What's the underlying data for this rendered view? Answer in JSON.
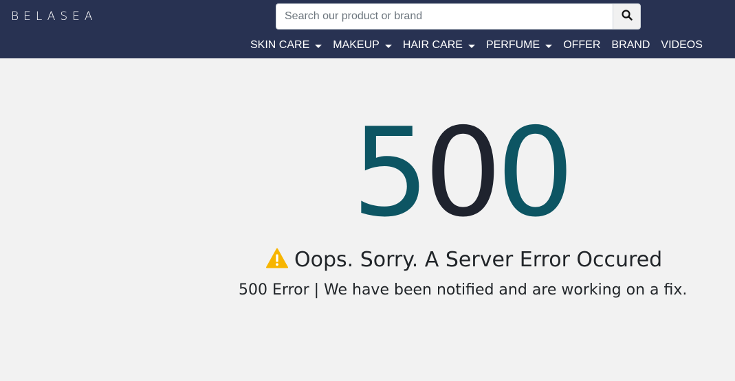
{
  "header": {
    "logo": "BELASEA",
    "search": {
      "placeholder": "Search our product or brand",
      "value": ""
    },
    "nav": [
      {
        "label": "SKIN CARE",
        "dropdown": true
      },
      {
        "label": "MAKEUP",
        "dropdown": true
      },
      {
        "label": "HAIR CARE",
        "dropdown": true
      },
      {
        "label": "PERFUME",
        "dropdown": true
      },
      {
        "label": "OFFER",
        "dropdown": false
      },
      {
        "label": "BRAND",
        "dropdown": false
      },
      {
        "label": "VIDEOS",
        "dropdown": false
      }
    ]
  },
  "error": {
    "code_digits": [
      "5",
      "0",
      "0"
    ],
    "title": "Oops. Sorry. A Server Error Occured",
    "message": "500 Error | We have been notified and are working on a fix.",
    "icon": "warning-icon"
  },
  "colors": {
    "header_bg": "#283252",
    "page_bg": "#f2f2f2",
    "teal": "#0d5563",
    "dark": "#1f232e",
    "warning": "#f7b500"
  }
}
